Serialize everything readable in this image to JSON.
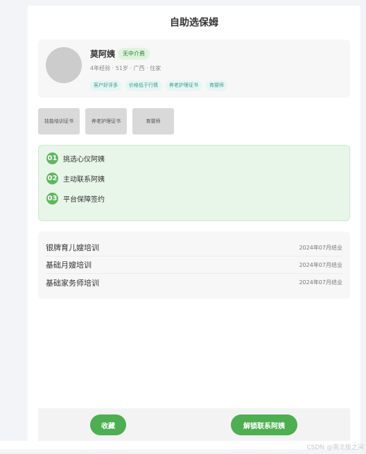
{
  "page": {
    "title": "自助选保姆"
  },
  "profile": {
    "name": "莫阿姨",
    "fee_badge": "无中介费",
    "meta": "4年经验 · 51岁 · 广西 · 住家",
    "tags": [
      "客户好评多",
      "价格低于行情",
      "养老护理证书",
      "育婴师"
    ]
  },
  "certificates": [
    "技能培训证书",
    "养老护理证书",
    "育婴师"
  ],
  "steps": [
    {
      "num": "01",
      "label": "挑选心仪阿姨"
    },
    {
      "num": "02",
      "label": "主动联系阿姨"
    },
    {
      "num": "03",
      "label": "平台保障签约"
    }
  ],
  "trainings": [
    {
      "name": "银牌育儿嫂培训",
      "date": "2024年07月结业"
    },
    {
      "name": "基础月嫂培训",
      "date": "2024年07月结业"
    },
    {
      "name": "基础家务师培训",
      "date": "2024年07月结业"
    }
  ],
  "actions": {
    "favorite_label": "收藏",
    "unlock_label": "解锁联系阿姨"
  },
  "watermark": "CSDN @南北极之间",
  "colors": {
    "accent": "#4caf50",
    "step_bg": "#e8f5e9",
    "tag_bg": "#e6f6f4",
    "badge_bg": "#dff4df"
  }
}
